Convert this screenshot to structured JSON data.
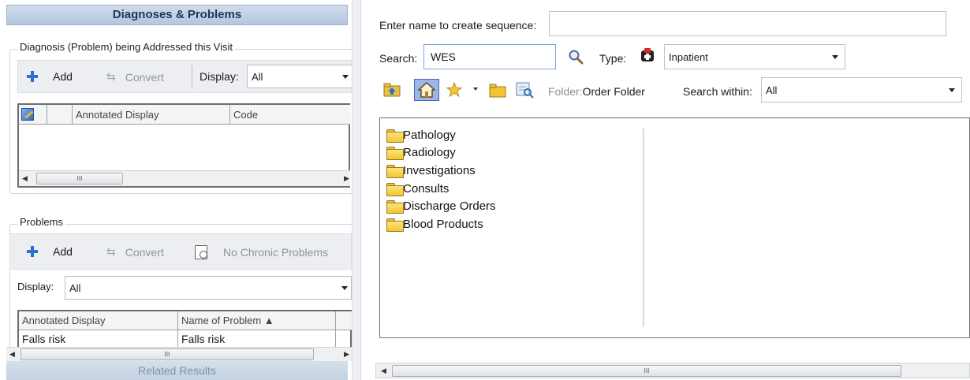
{
  "left_panel": {
    "header": "Diagnoses & Problems",
    "diagnosis_section": {
      "title": "Diagnosis (Problem) being Addressed this Visit",
      "toolbar": {
        "add_label": "Add",
        "convert_label": "Convert",
        "display_label": "Display:",
        "display_value": "All"
      },
      "grid_columns": [
        "Annotated Display",
        "Code"
      ],
      "scroll_thumb_label": "III"
    },
    "problems_section": {
      "title": "Problems",
      "toolbar": {
        "add_label": "Add",
        "convert_label": "Convert",
        "no_chronic_label": "No Chronic Problems"
      },
      "display_label": "Display:",
      "display_value": "All",
      "grid_columns": [
        "Annotated Display",
        "Name of Problem ▲"
      ],
      "rows": [
        {
          "annotated_display": "Falls risk",
          "name_of_problem": "Falls risk"
        }
      ],
      "scroll_thumb_label": "III"
    },
    "footer": "Related Results"
  },
  "right_panel": {
    "sequence_label": "Enter name to create sequence:",
    "sequence_value": "",
    "search_label": "Search:",
    "search_value": "WES",
    "type_label": "Type:",
    "type_value": "Inpatient",
    "folder_prefix": "Folder:",
    "folder_name": "Order Folder",
    "search_within_label": "Search within:",
    "search_within_value": "All",
    "folders": [
      "Pathology",
      "Radiology",
      "Investigations",
      "Consults",
      "Discharge Orders",
      "Blood Products"
    ],
    "scroll_thumb_label": "III",
    "icons": [
      "folder-up-icon",
      "home-icon",
      "star-icon",
      "dropdown-arrow-icon",
      "folder-icon",
      "search-folder-icon",
      "magnifier-icon",
      "inpatient-type-icon",
      "checkbox-icon"
    ]
  }
}
